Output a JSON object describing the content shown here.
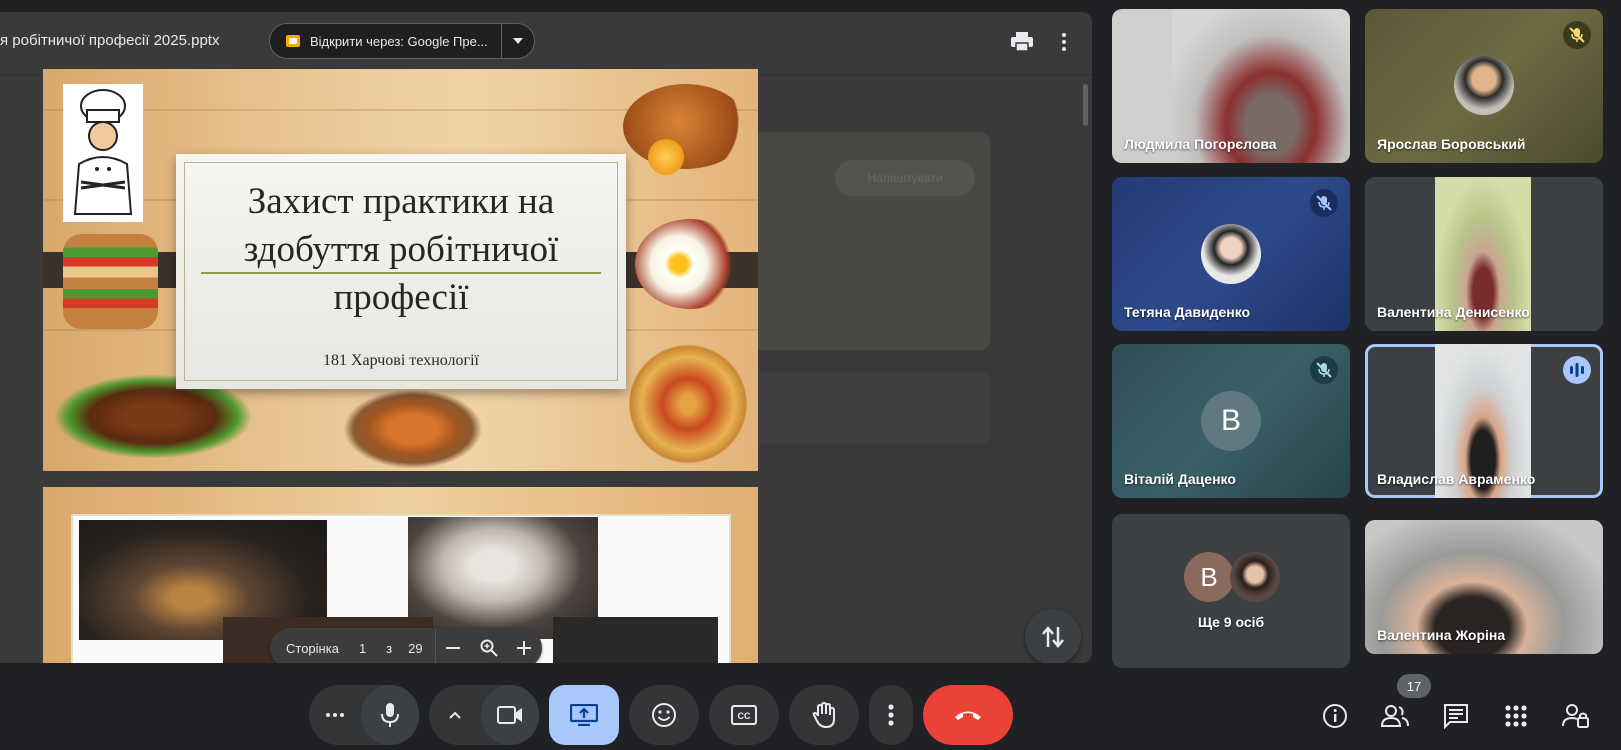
{
  "presentation": {
    "file_title": "я робітничої професії 2025.pptx",
    "open_with_label": "Відкрити через: Google Пре...",
    "ghost_pill_label": "Налаштувати",
    "slide1": {
      "title": "Захист практики на здобуття робітничої професії",
      "subtitle": "181 Харчові технології"
    },
    "page_controls": {
      "label": "Сторінка",
      "current": "1",
      "of": "з",
      "total": "29"
    }
  },
  "participants": [
    {
      "name": "Людмила Погорєлова",
      "muted": false,
      "colors": {
        "bg": "#c9c9c7"
      }
    },
    {
      "name": "Ярослав Боровський",
      "muted": true,
      "colors": {
        "bg": "#5b5a3a"
      }
    },
    {
      "name": "Тетяна Давиденко",
      "muted": true,
      "colors": {
        "bg": "#2a3f7a"
      }
    },
    {
      "name": "Валентина Денисенко",
      "muted": false,
      "colors": {
        "bg": "#3c4043"
      }
    },
    {
      "name": "Віталій Даценко",
      "muted": true,
      "avatar_letter": "В",
      "colors": {
        "bg": "#3a5a63"
      }
    },
    {
      "name": "Владислав Авраменко",
      "muted": false,
      "speaking": true,
      "colors": {
        "bg": "#3c4043"
      }
    },
    {
      "name": "Ще 9 осіб",
      "avatar_letter": "В",
      "colors": {
        "bg": "#3c4043"
      }
    },
    {
      "name": "Валентина Жоріна",
      "muted": false,
      "colors": {
        "bg": "#9a9a98"
      }
    }
  ],
  "toolbar": {
    "end_call_color": "#ea4335",
    "present_active_color": "#a8c7fa",
    "people_count": "17",
    "icons": [
      "more-icon",
      "mic-icon",
      "chevron-up-icon",
      "camera-icon",
      "present-icon",
      "emoji-icon",
      "captions-icon",
      "hand-icon",
      "more-vert-icon",
      "end-call-icon",
      "info-icon",
      "people-icon",
      "chat-icon",
      "apps-icon",
      "host-controls-icon"
    ]
  }
}
